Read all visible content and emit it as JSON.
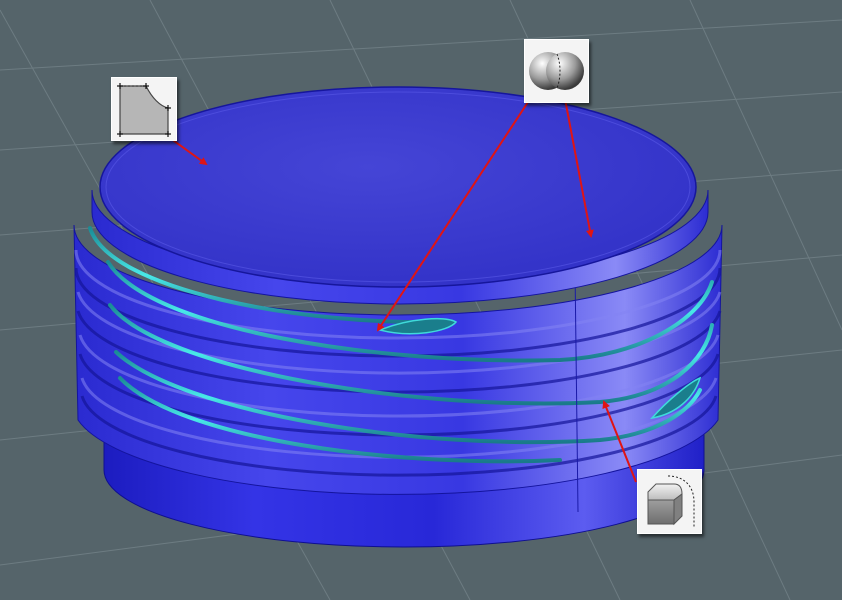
{
  "viewport": {
    "background_color": "#55646a",
    "grid_color": "#6d7c82",
    "model_color": "#2a2ad8",
    "model_highlight_color": "#6a6af0",
    "groove_color": "#37d2d2",
    "arrow_color": "#e01414"
  },
  "tools": [
    {
      "name": "fillet-surface-icon"
    },
    {
      "name": "sphere-blend-icon"
    },
    {
      "name": "edge-fillet-icon"
    }
  ]
}
